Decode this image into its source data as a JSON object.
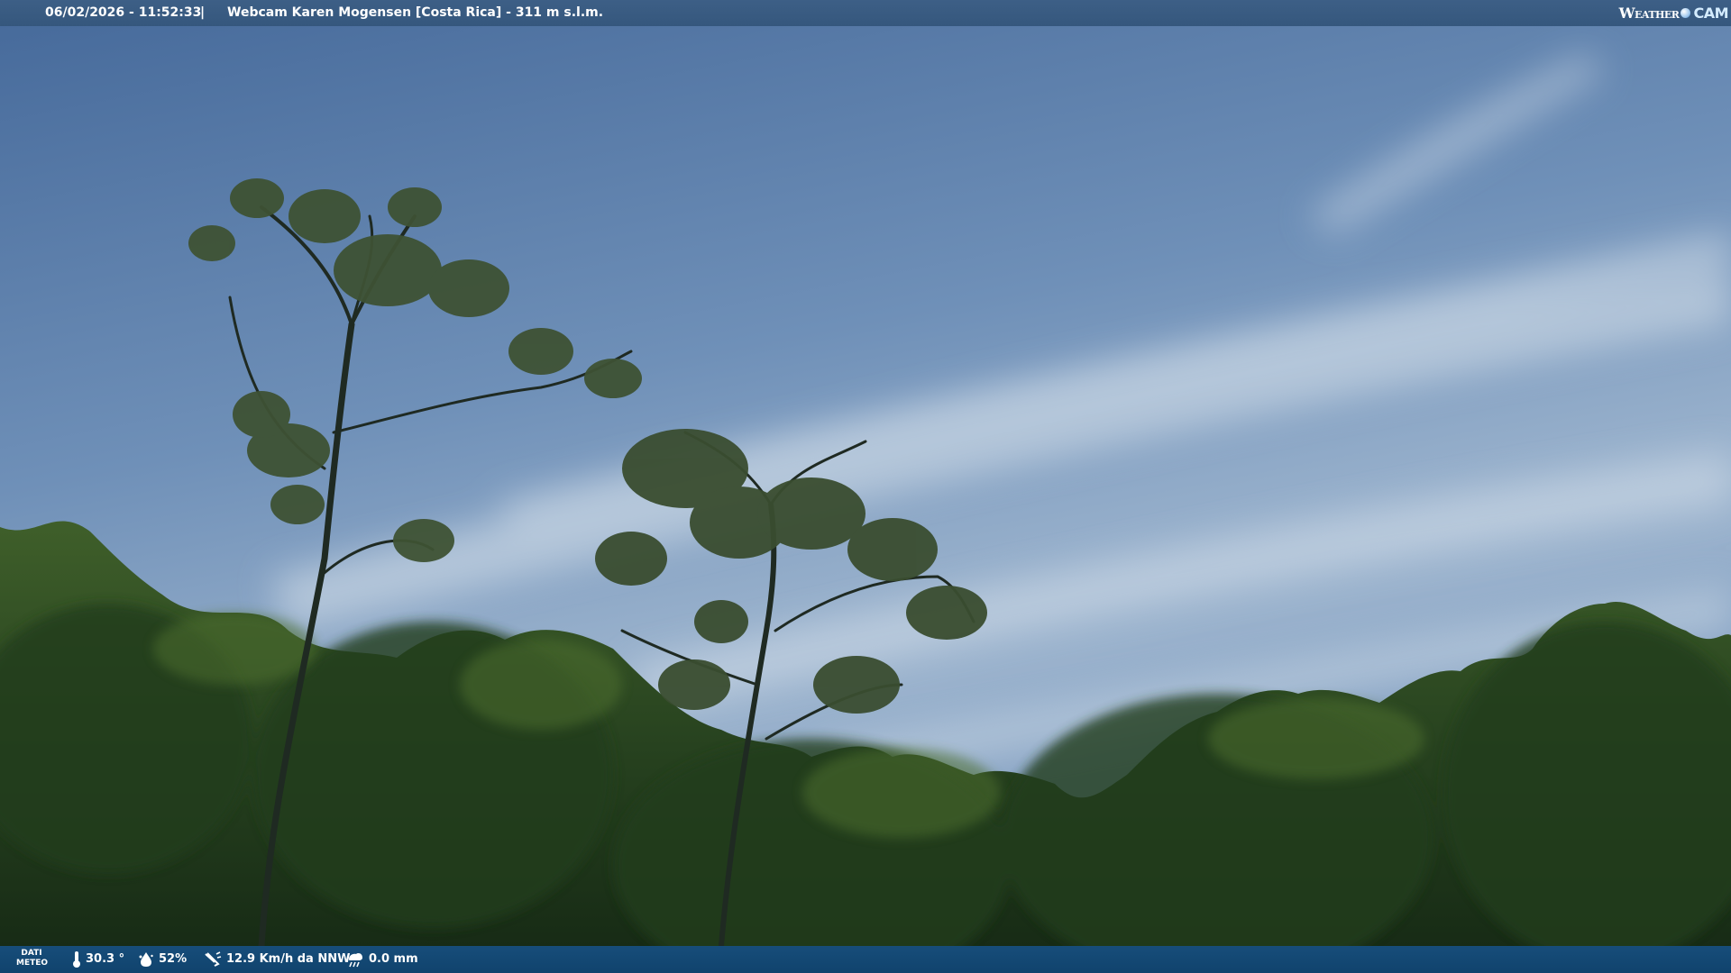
{
  "header": {
    "datetime": "06/02/2026 - 11:52:33",
    "separator": "|",
    "title": "Webcam Karen Mogensen [Costa Rica] - 311 m s.l.m.",
    "logo_weather": "Weather",
    "logo_cam": "CAM"
  },
  "footer": {
    "section_label_line1": "DATI",
    "section_label_line2": "METEO",
    "temperature": "30.3 °",
    "humidity": "52%",
    "wind": "12.9 Km/h da NNW",
    "rain": "0.0 mm"
  },
  "icons": {
    "temperature": "thermometer-icon",
    "humidity": "humidity-drop-icon",
    "wind": "wind-icon",
    "rain": "rain-icon",
    "logo": "globe-icon"
  },
  "colors": {
    "sky_top": "#4d72a3",
    "sky_haze": "#b6c7d8",
    "foliage_dark": "#1c3218",
    "foliage_light": "#5d7c35",
    "top_bar": "#3a5c83",
    "bottom_bar": "#134874"
  }
}
